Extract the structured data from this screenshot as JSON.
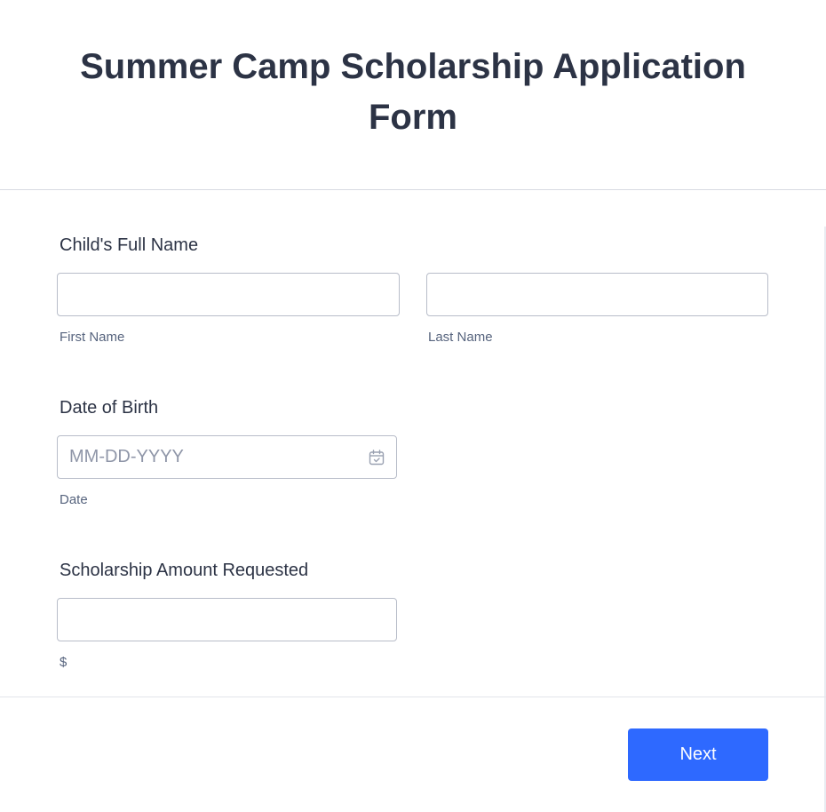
{
  "form": {
    "title": "Summer Camp Scholarship Application Form"
  },
  "fields": {
    "child_name": {
      "label": "Child's Full Name",
      "first": {
        "value": "",
        "sublabel": "First Name"
      },
      "last": {
        "value": "",
        "sublabel": "Last Name"
      }
    },
    "date_of_birth": {
      "label": "Date of Birth",
      "value": "",
      "placeholder": "MM-DD-YYYY",
      "sublabel": "Date",
      "icon": "calendar-check-icon"
    },
    "scholarship_amount": {
      "label": "Scholarship Amount Requested",
      "value": "",
      "sublabel": "$"
    }
  },
  "footer": {
    "next_label": "Next"
  },
  "colors": {
    "accent": "#2e69ff",
    "text": "#2c3345",
    "sublabel": "#57647e",
    "border": "#b8bdc9"
  }
}
